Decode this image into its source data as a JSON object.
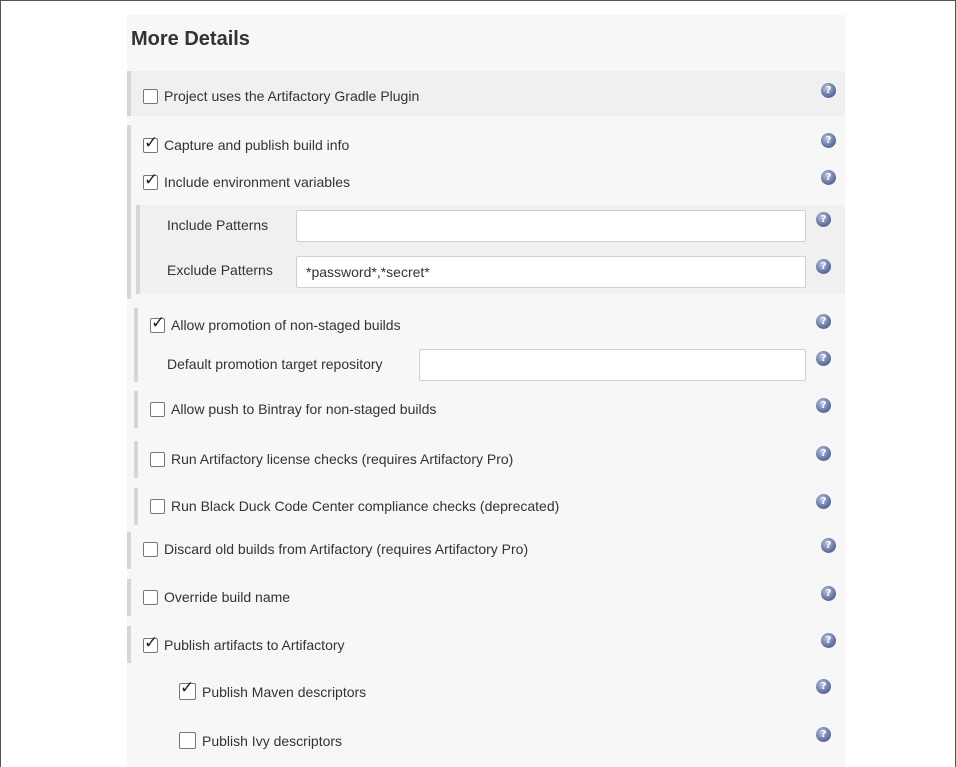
{
  "section": {
    "title": "More Details"
  },
  "options": {
    "gradle_plugin": {
      "label": "Project uses the Artifactory Gradle Plugin",
      "checked": false
    },
    "capture_build_info": {
      "label": "Capture and publish build info",
      "checked": true
    },
    "include_env_vars": {
      "label": "Include environment variables",
      "checked": true
    },
    "allow_promotion": {
      "label": "Allow promotion of non-staged builds",
      "checked": true
    },
    "allow_bintray": {
      "label": "Allow push to Bintray for non-staged builds",
      "checked": false
    },
    "license_checks": {
      "label": "Run Artifactory license checks (requires Artifactory Pro)",
      "checked": false
    },
    "black_duck": {
      "label": "Run Black Duck Code Center compliance checks (deprecated)",
      "checked": false
    },
    "discard_old_builds": {
      "label": "Discard old builds from Artifactory (requires Artifactory Pro)",
      "checked": false
    },
    "override_build_name": {
      "label": "Override build name",
      "checked": false
    },
    "publish_artifacts": {
      "label": "Publish artifacts to Artifactory",
      "checked": true
    },
    "publish_maven": {
      "label": "Publish Maven descriptors",
      "checked": true
    },
    "publish_ivy": {
      "label": "Publish Ivy descriptors",
      "checked": false
    }
  },
  "fields": {
    "include_patterns": {
      "label": "Include Patterns",
      "value": ""
    },
    "exclude_patterns": {
      "label": "Exclude Patterns",
      "value": "*password*,*secret*"
    },
    "promotion_target": {
      "label": "Default promotion target repository",
      "value": ""
    }
  },
  "help_icon": {
    "symbol": "?"
  }
}
